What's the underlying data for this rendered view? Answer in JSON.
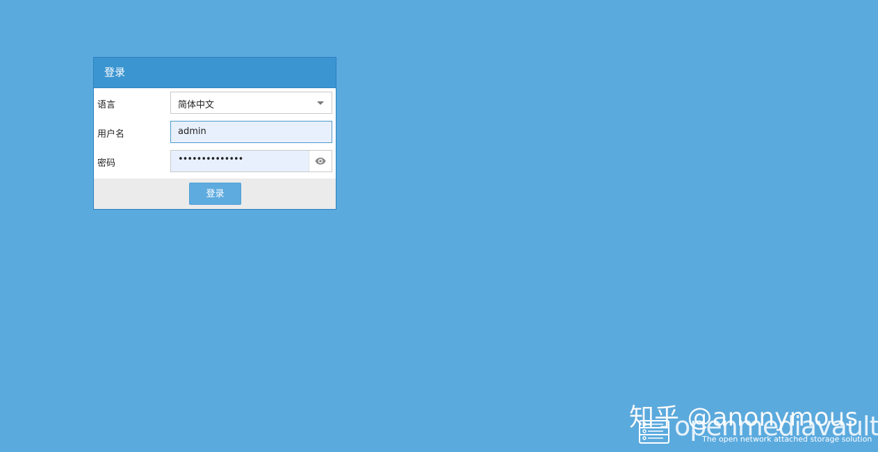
{
  "login": {
    "title": "登录",
    "language_label": "语言",
    "language_value": "简体中文",
    "username_label": "用户名",
    "username_value": "admin",
    "password_label": "密码",
    "password_value": "••••••••••••••",
    "submit_label": "登录"
  },
  "watermark": {
    "text": "知乎 @anonymous"
  },
  "brand": {
    "name": "openmediavault",
    "tagline": "The open network attached storage solution"
  },
  "colors": {
    "background": "#5baade",
    "header": "#3b95d1",
    "button": "#5eabdf"
  }
}
